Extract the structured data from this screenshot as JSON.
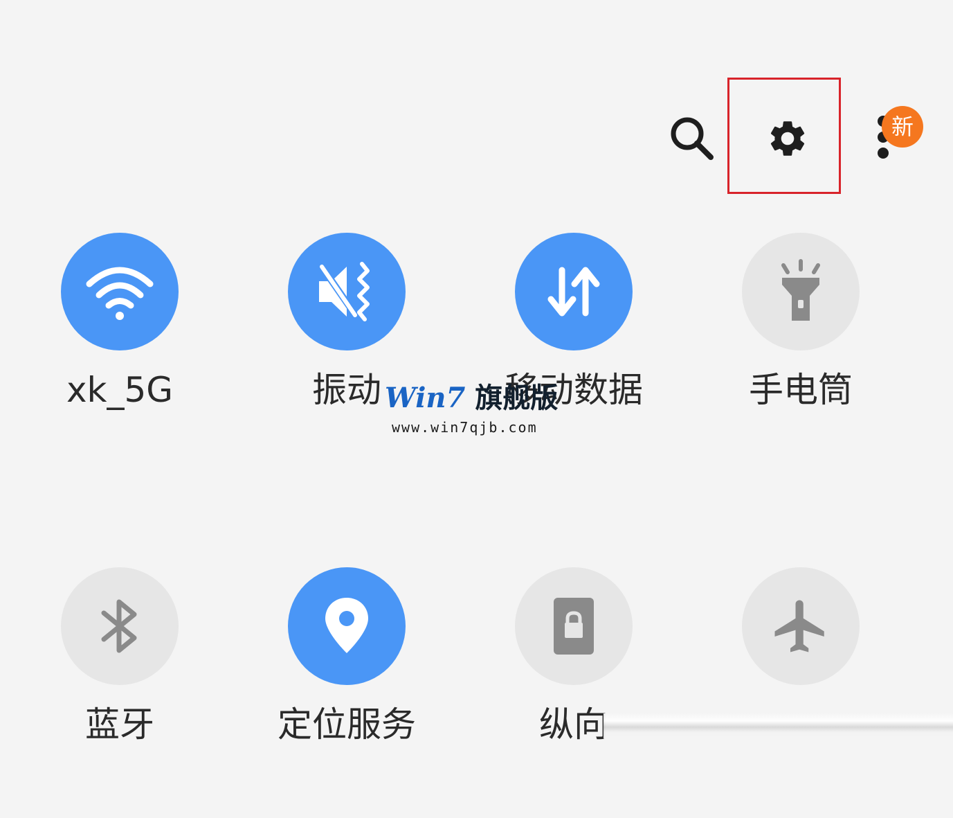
{
  "topbar": {
    "search_icon": "search-icon",
    "settings_icon": "gear-icon",
    "more_icon": "more-vertical-icon",
    "badge_text": "新"
  },
  "tiles": [
    {
      "label": "xk_5G",
      "icon": "wifi-icon",
      "state": "on"
    },
    {
      "label": "振动",
      "icon": "vibrate-icon",
      "state": "on"
    },
    {
      "label": "移动数据",
      "icon": "mobile-data-icon",
      "state": "on"
    },
    {
      "label": "手电筒",
      "icon": "flashlight-icon",
      "state": "off"
    },
    {
      "label": "蓝牙",
      "icon": "bluetooth-icon",
      "state": "off"
    },
    {
      "label": "定位服务",
      "icon": "location-icon",
      "state": "on"
    },
    {
      "label": "纵向",
      "icon": "portrait-lock-icon",
      "state": "off"
    },
    {
      "label": "",
      "icon": "airplane-icon",
      "state": "off"
    }
  ],
  "watermark": {
    "title": "Win7",
    "title_cn": "旗舰版",
    "url": "www.win7qjb.com"
  },
  "colors": {
    "accent": "#4a96f6",
    "inactive": "#e6e6e6",
    "highlight": "#d8232a",
    "badge": "#f5771f",
    "background": "#f4f4f4"
  }
}
